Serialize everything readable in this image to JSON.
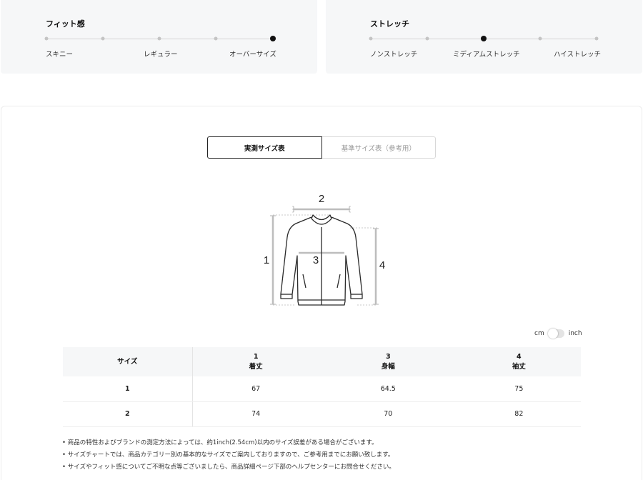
{
  "fit": {
    "title": "フィット感",
    "labels": [
      "スキニー",
      "レギュラー",
      "オーバーサイズ"
    ],
    "steps": 5,
    "selected_index": 4
  },
  "stretch": {
    "title": "ストレッチ",
    "labels": [
      "ノンストレッチ",
      "ミディアムストレッチ",
      "ハイストレッチ"
    ],
    "steps": 5,
    "selected_index": 2
  },
  "tabs": {
    "measured": "実測サイズ表",
    "standard": "基準サイズ表（参考用）"
  },
  "illustration": {
    "label_1": "1",
    "label_2": "2",
    "label_3": "3",
    "label_4": "4"
  },
  "unit_toggle": {
    "left": "cm",
    "right": "inch",
    "selected": "cm"
  },
  "table": {
    "size_header": "サイズ",
    "columns": [
      {
        "num": "1",
        "name": "着丈"
      },
      {
        "num": "3",
        "name": "身幅"
      },
      {
        "num": "4",
        "name": "袖丈"
      }
    ],
    "rows": [
      {
        "size": "1",
        "values": [
          "67",
          "64.5",
          "75"
        ]
      },
      {
        "size": "2",
        "values": [
          "74",
          "70",
          "82"
        ]
      }
    ]
  },
  "notes": [
    "商品の特性およびブランドの測定方法によっては、約1inch(2.54cm)以内のサイズ誤差がある場合がございます。",
    "サイズチャートでは、商品カテゴリー別の基本的なサイズでご案内しておりますので、ご参考用までにお願い致します。",
    "サイズやフィット感についてご不明な点等ございましたら、商品詳細ページ下部のヘルプセンターにお問合せください。"
  ]
}
